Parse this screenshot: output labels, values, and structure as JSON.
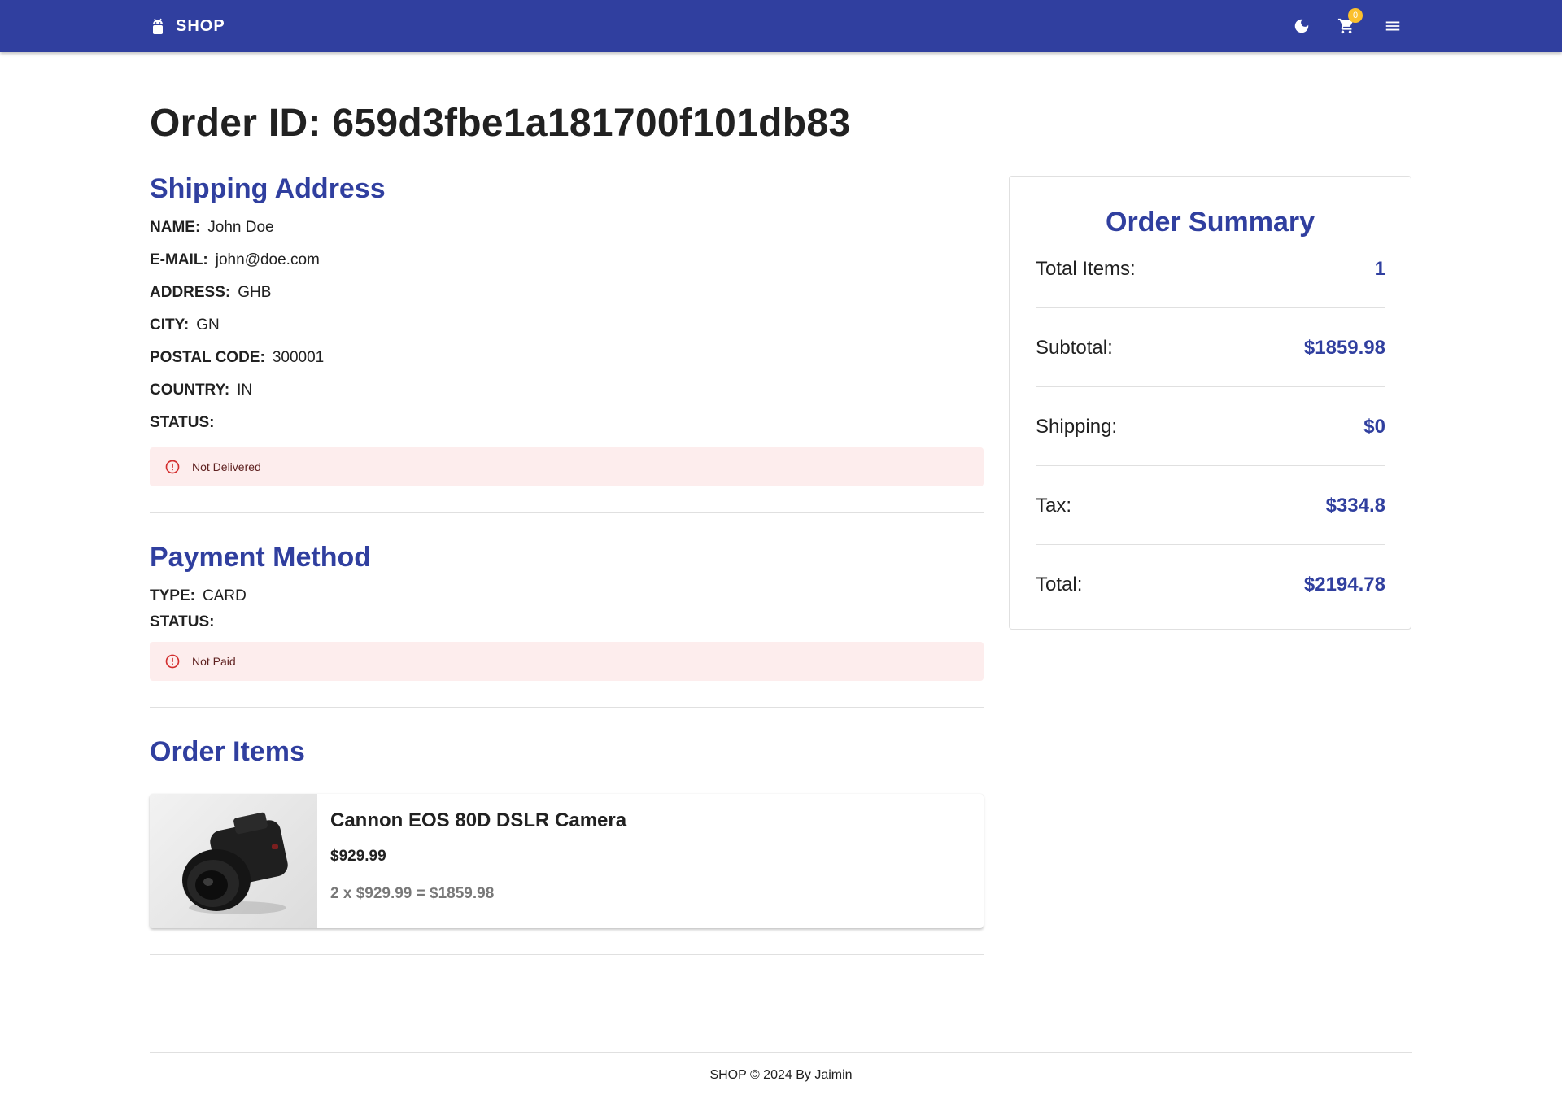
{
  "appbar": {
    "brand": "SHOP",
    "brand_icon": "android-icon",
    "cart_count": "0",
    "icons": [
      "dark-mode-icon",
      "cart-icon",
      "menu-icon"
    ]
  },
  "order": {
    "title": "Order ID: 659d3fbe1a181700f101db83"
  },
  "shipping": {
    "title": "Shipping Address",
    "name_label": "NAME:",
    "name": "John Doe",
    "email_label": "E-MAIL:",
    "email": "john@doe.com",
    "address_label": "ADDRESS:",
    "address": "GHB",
    "city_label": "CITY:",
    "city": "GN",
    "postal_label": "POSTAL CODE:",
    "postal": "300001",
    "country_label": "COUNTRY:",
    "country": "IN",
    "status_label": "STATUS:",
    "status": "Not Delivered"
  },
  "payment": {
    "title": "Payment Method",
    "type_label": "TYPE:",
    "type": "CARD",
    "status_label": "STATUS:",
    "status": "Not Paid"
  },
  "items": {
    "title": "Order Items",
    "list": [
      {
        "name": "Cannon EOS 80D DSLR Camera",
        "price": "$929.99",
        "calc": "2 x $929.99 = $1859.98"
      }
    ]
  },
  "summary": {
    "title": "Order Summary",
    "rows": [
      {
        "label": "Total Items:",
        "value": "1"
      },
      {
        "label": "Subtotal:",
        "value": "$1859.98"
      },
      {
        "label": "Shipping:",
        "value": "$0"
      },
      {
        "label": "Tax:",
        "value": "$334.8"
      },
      {
        "label": "Total:",
        "value": "$2194.78"
      }
    ]
  },
  "footer": {
    "text": "SHOP © 2024 By Jaimin"
  },
  "colors": {
    "primary": "#303f9f",
    "badge": "#fbc02d",
    "error_bg": "#fdeded",
    "error_icon": "#d32f2f"
  }
}
